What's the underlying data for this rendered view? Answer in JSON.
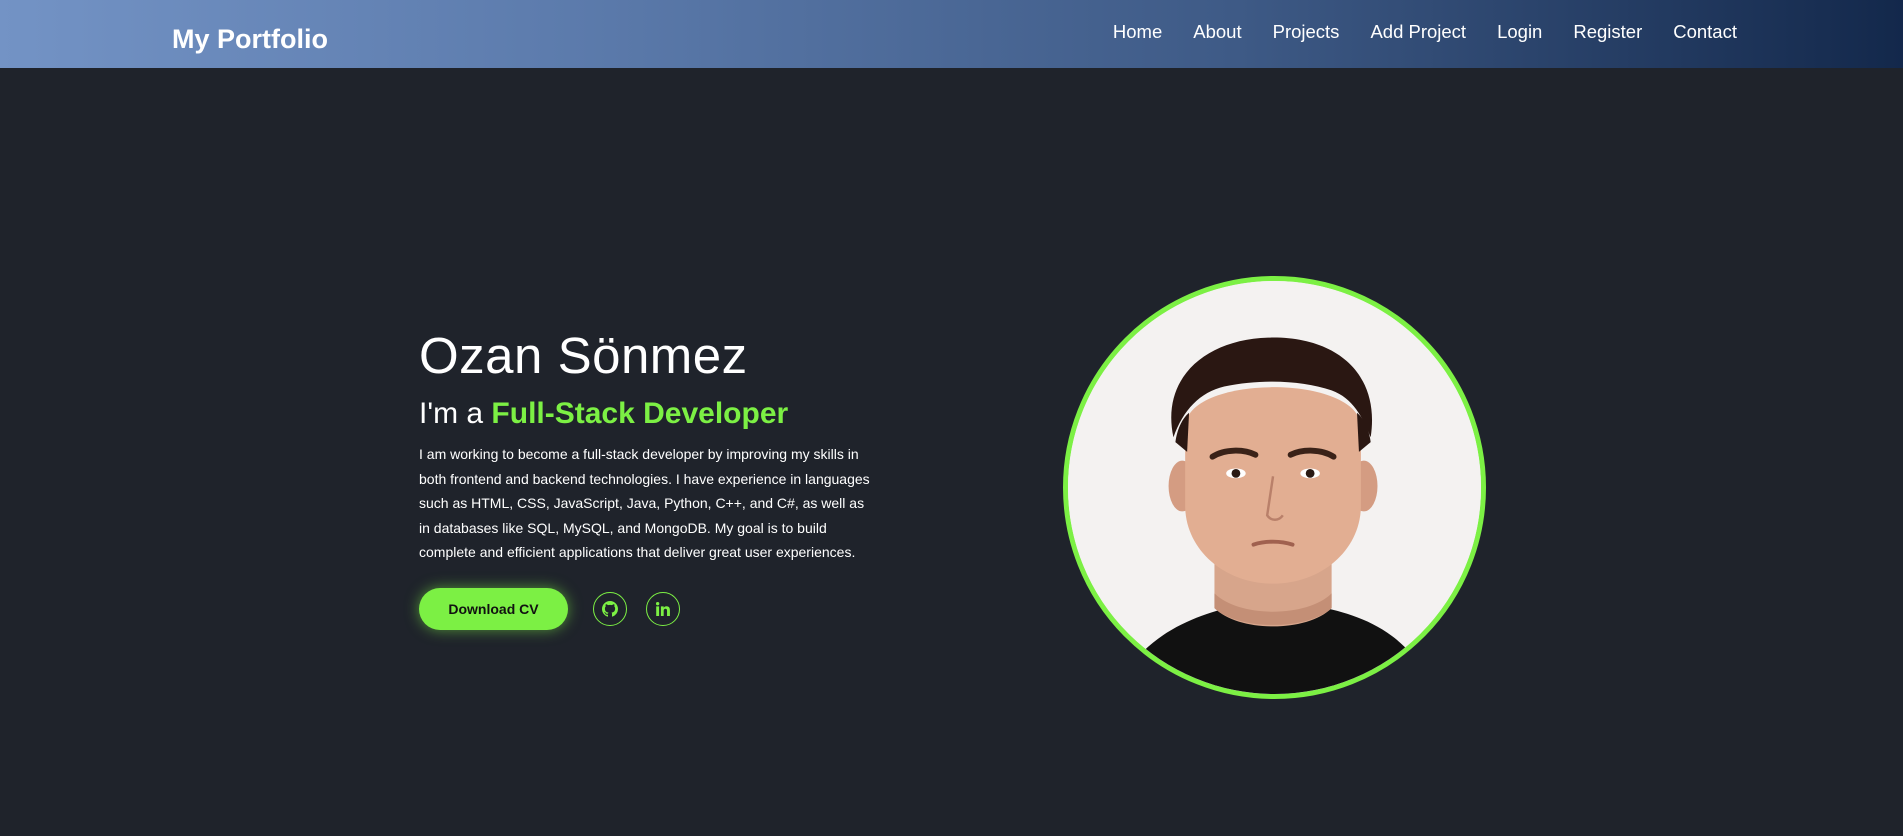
{
  "header": {
    "brand": "My Portfolio",
    "nav": [
      "Home",
      "About",
      "Projects",
      "Add Project",
      "Login",
      "Register",
      "Contact"
    ]
  },
  "hero": {
    "name": "Ozan Sönmez",
    "role_prefix": "I'm a ",
    "role_highlight": "Full-Stack Developer",
    "description": "I am working to become a full-stack developer by improving my skills in both frontend and backend technologies. I have experience in languages such as HTML, CSS, JavaScript, Java, Python, C++, and C#, as well as in databases like SQL, MySQL, and MongoDB. My goal is to build complete and efficient applications that deliver great user experiences.",
    "cv_button": "Download CV",
    "social_icons": [
      "github-icon",
      "linkedin-icon"
    ]
  },
  "colors": {
    "background": "#1f232b",
    "accent": "#7cf044",
    "header_gradient_start": "#7393c5",
    "header_gradient_end": "#13284b"
  }
}
